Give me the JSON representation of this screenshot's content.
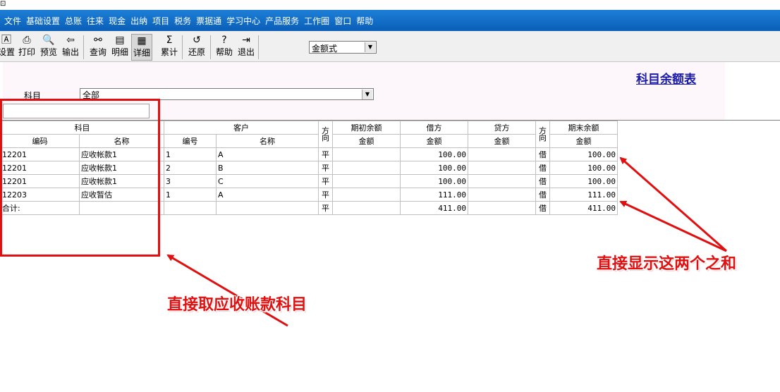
{
  "app_icon": "app-icon",
  "menu": [
    "文件",
    "基础设置",
    "总账",
    "往来",
    "现金",
    "出纳",
    "项目",
    "税务",
    "票据通",
    "学习中心",
    "产品服务",
    "工作圈",
    "窗口",
    "帮助"
  ],
  "toolbar": {
    "settings": "设置",
    "print": "打印",
    "preview": "预览",
    "export": "输出",
    "query": "查询",
    "detail": "明细",
    "detailed": "详细",
    "cumulative": "累计",
    "restore": "还原",
    "help": "帮助",
    "exit": "退出"
  },
  "format_select": {
    "value": "金额式"
  },
  "report": {
    "title": "科目余额表",
    "subject_label": "科目",
    "subject_value": "全部"
  },
  "table": {
    "group_headers": {
      "subject": "科目",
      "customer": "客户",
      "direction": "方向",
      "opening": "期初余额",
      "debit": "借方",
      "credit": "贷方",
      "closing": "期末余额"
    },
    "sub_headers": {
      "code": "编码",
      "name": "名称",
      "cust_no": "编号",
      "cust_name": "名称",
      "amount": "金额"
    },
    "rows": [
      {
        "code": "12201",
        "name": "应收帐款1",
        "cust_no": "1",
        "cust_name": "A",
        "dir1": "平",
        "opening": "",
        "debit": "100.00",
        "credit": "",
        "dir2": "借",
        "closing": "100.00"
      },
      {
        "code": "12201",
        "name": "应收帐款1",
        "cust_no": "2",
        "cust_name": "B",
        "dir1": "平",
        "opening": "",
        "debit": "100.00",
        "credit": "",
        "dir2": "借",
        "closing": "100.00"
      },
      {
        "code": "12201",
        "name": "应收帐款1",
        "cust_no": "3",
        "cust_name": "C",
        "dir1": "平",
        "opening": "",
        "debit": "100.00",
        "credit": "",
        "dir2": "借",
        "closing": "100.00"
      },
      {
        "code": "12203",
        "name": "应收暂估",
        "cust_no": "1",
        "cust_name": "A",
        "dir1": "平",
        "opening": "",
        "debit": "111.00",
        "credit": "",
        "dir2": "借",
        "closing": "111.00"
      }
    ],
    "total": {
      "label": "合计:",
      "dir1": "平",
      "debit": "411.00",
      "dir2": "借",
      "closing": "411.00"
    }
  },
  "annotations": {
    "left_note": "直接取应收账款科目",
    "right_note": "直接显示这两个之和",
    "color": "#e01010"
  }
}
